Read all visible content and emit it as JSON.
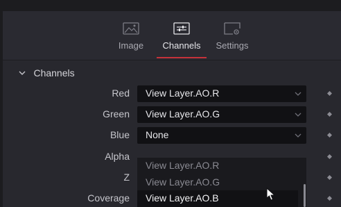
{
  "tabs": [
    {
      "label": "Image",
      "icon": "image-icon",
      "active": false
    },
    {
      "label": "Channels",
      "icon": "channels-sliders-icon",
      "active": true
    },
    {
      "label": "Settings",
      "icon": "settings-icon",
      "active": false
    }
  ],
  "section": {
    "title": "Channels",
    "expanded": true
  },
  "rows": [
    {
      "label": "Red",
      "value": "View Layer.AO.R"
    },
    {
      "label": "Green",
      "value": "View Layer.AO.G"
    },
    {
      "label": "Blue",
      "value": "None"
    },
    {
      "label": "Alpha"
    },
    {
      "label": "Z"
    },
    {
      "label": "Coverage"
    }
  ],
  "dropdown_menu": {
    "items": [
      "View Layer.AO.R",
      "View Layer.AO.G",
      "View Layer.AO.B"
    ],
    "hovered": "View Layer.AO.B"
  },
  "colors": {
    "accent": "#c5323a",
    "panel_bg": "#28282e",
    "field_bg": "#111114"
  }
}
